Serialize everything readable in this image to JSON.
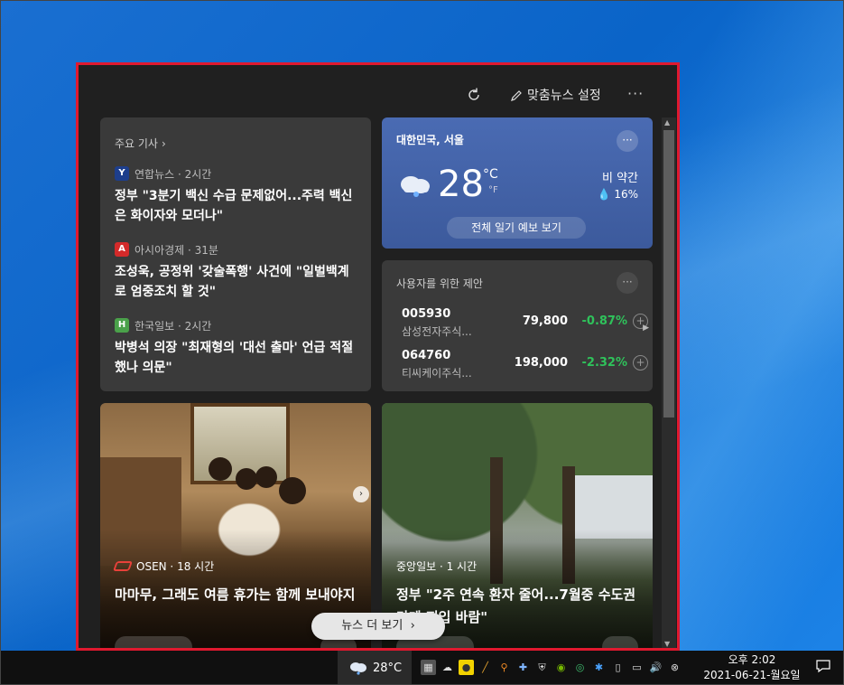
{
  "header": {
    "personalize_label": "맞춤뉴스 설정",
    "more_label": "···"
  },
  "top_stories": {
    "title": "주요 기사",
    "items": [
      {
        "source": "연합뉴스 · 2시간",
        "logo_color": "#1d3e8c",
        "logo_text": "Y",
        "headline": "정부 \"3분기 백신 수급 문제없어...주력 백신은 화이자와 모더나\""
      },
      {
        "source": "아시아경제 · 31분",
        "logo_color": "#d42a2a",
        "logo_text": "A",
        "headline": "조성욱, 공정위 '갖술폭행' 사건에 \"일벌백계로 엄중조치 할 것\""
      },
      {
        "source": "한국일보 · 2시간",
        "logo_color": "#4aa14a",
        "logo_text": "H",
        "headline": "박병석 의장 \"최재형의 '대선 출마' 언급 적절했나 의문\""
      }
    ]
  },
  "weather": {
    "location": "대한민국, 서울",
    "temp": "28",
    "unit_c": "°C",
    "unit_f": "°F",
    "condition": "비 약간",
    "rain": "16%",
    "forecast_label": "전체 일기 예보 보기",
    "more_label": "···"
  },
  "stocks": {
    "title": "사용자를 위한 제안",
    "more_label": "···",
    "items": [
      {
        "code": "005930",
        "name": "삼성전자주식...",
        "price": "79,800",
        "change": "-0.87%"
      },
      {
        "code": "064760",
        "name": "티씨케이주식...",
        "price": "198,000",
        "change": "-2.32%"
      }
    ]
  },
  "photo_cards": [
    {
      "source": "OSEN · 18 시간",
      "headline": "마마무, 그래도 여름 휴가는 함께 보내야지"
    },
    {
      "source": "중앙일보 · 1 시간",
      "headline": "정부 \"2주 연속 환자 줄어...7월중 수도권 단계 진입 바람\""
    }
  ],
  "see_more_label": "뉴스 더 보기",
  "taskbar": {
    "weather_temp": "28°C",
    "clock_time": "오후 2:02",
    "clock_date": "2021-06-21-월요일"
  },
  "colors": {
    "panel_border": "#e0192f",
    "stock_change": "#2fc25b",
    "weather_card": "#4a6bb3"
  }
}
